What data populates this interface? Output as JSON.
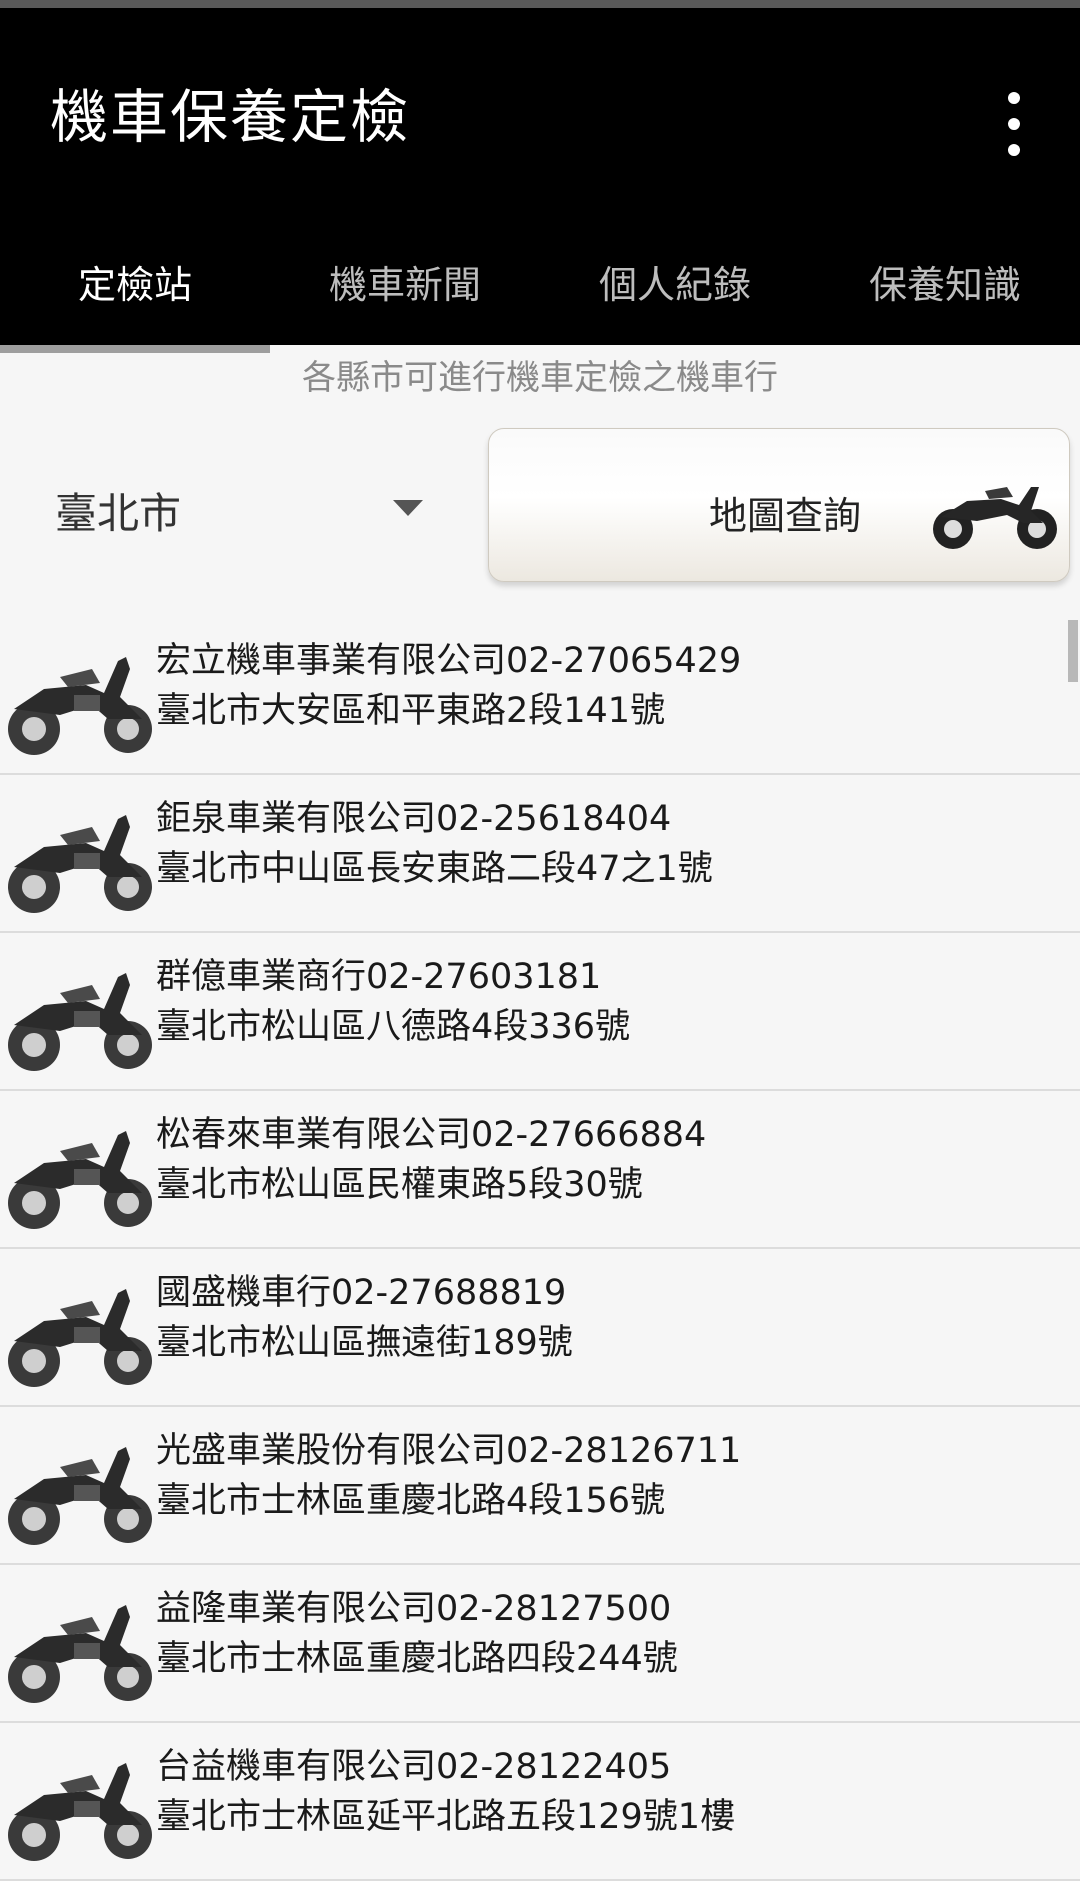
{
  "app": {
    "title": "機車保養定檢"
  },
  "menu": {
    "overflow_icon": "more-vert-icon"
  },
  "tabs": [
    {
      "label": "定檢站",
      "active": true
    },
    {
      "label": "機車新聞",
      "active": false
    },
    {
      "label": "個人紀錄",
      "active": false
    },
    {
      "label": "保養知識",
      "active": false
    }
  ],
  "header": {
    "subtitle": "各縣市可進行機車定檢之機車行"
  },
  "city_select": {
    "value": "臺北市"
  },
  "map_button": {
    "label": "地圖查詢",
    "icon": "motorcycle-icon"
  },
  "shops": [
    {
      "name": "宏立機車事業有限公司02-27065429",
      "address": "臺北市大安區和平東路2段141號"
    },
    {
      "name": "鉅泉車業有限公司02-25618404",
      "address": "臺北市中山區長安東路二段47之1號"
    },
    {
      "name": "群億車業商行02-27603181",
      "address": "臺北市松山區八德路4段336號"
    },
    {
      "name": "松春來車業有限公司02-27666884",
      "address": "臺北市松山區民權東路5段30號"
    },
    {
      "name": "國盛機車行02-27688819",
      "address": "臺北市松山區撫遠街189號"
    },
    {
      "name": "光盛車業股份有限公司02-28126711",
      "address": "臺北市士林區重慶北路4段156號"
    },
    {
      "name": "益隆車業有限公司02-28127500",
      "address": "臺北市士林區重慶北路四段244號"
    },
    {
      "name": "台益機車有限公司02-28122405",
      "address": "臺北市士林區延平北路五段129號1樓"
    }
  ],
  "colors": {
    "appbar": "#000000",
    "tab_indicator": "#9e9e9e",
    "background": "#f6f6f6"
  }
}
